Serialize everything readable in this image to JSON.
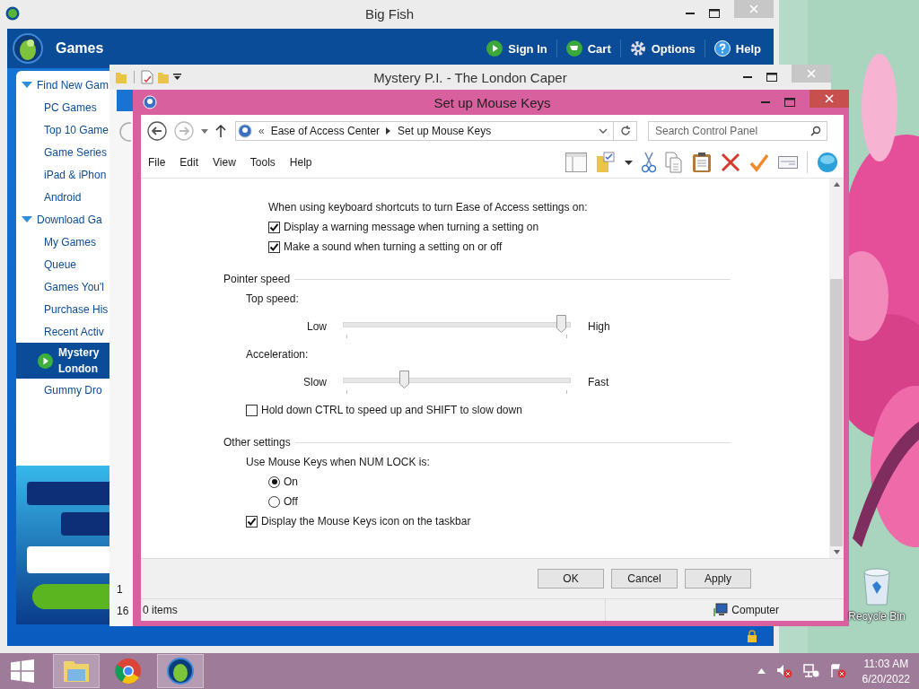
{
  "desktop": {
    "icons": [
      {
        "label": "Recycle Bin"
      }
    ]
  },
  "big_fish": {
    "title": "Big Fish",
    "brand": "Games",
    "nav": [
      {
        "kind": "play",
        "label": "Sign In"
      },
      {
        "kind": "cart",
        "label": "Cart"
      },
      {
        "kind": "gear",
        "label": "Options"
      },
      {
        "kind": "help",
        "label": "Help"
      }
    ],
    "sidebar": [
      {
        "kind": "header",
        "label": "Find New Gam",
        "expanded": true,
        "children": [
          {
            "lines": [
              "PC Games"
            ],
            "selected": false
          },
          {
            "lines": [
              "Top 10 Game"
            ],
            "selected": false
          },
          {
            "lines": [
              "Game Series"
            ],
            "selected": false
          },
          {
            "lines": [
              "iPad & iPhon"
            ],
            "selected": false
          },
          {
            "lines": [
              "Android"
            ],
            "selected": false
          }
        ]
      },
      {
        "kind": "header",
        "label": "Download Ga",
        "expanded": true,
        "children": [
          {
            "lines": [
              "My Games"
            ],
            "selected": false
          },
          {
            "lines": [
              "Queue"
            ],
            "selected": false
          },
          {
            "lines": [
              "Games You'l"
            ],
            "selected": false
          },
          {
            "lines": [
              "Purchase His"
            ],
            "selected": false
          },
          {
            "lines": [
              "Recent Activ"
            ],
            "selected": false
          },
          {
            "lines": [
              "Mystery",
              "London"
            ],
            "selected": true
          },
          {
            "lines": [
              "Gummy Dro"
            ],
            "selected": false
          }
        ]
      }
    ]
  },
  "mystery_window": {
    "title": "Mystery P.I. - The London Caper",
    "fragments": [
      "1",
      "16"
    ]
  },
  "mouse_keys": {
    "title": "Set up Mouse Keys",
    "nav": [
      {
        "kind": "back",
        "disabled": false
      },
      {
        "kind": "forward",
        "disabled": true
      }
    ],
    "address_prefix": "«",
    "breadcrumbs": [
      "Ease of Access Center",
      "Set up Mouse Keys"
    ],
    "search": {
      "placeholder": "Search Control Panel"
    },
    "menu": [
      "File",
      "Edit",
      "View",
      "Tools",
      "Help"
    ],
    "settings": [
      {
        "kind": "subsection",
        "label": "When using keyboard shortcuts to turn Ease of Access settings on:",
        "children": [
          {
            "kind": "checkbox",
            "label": "Display a warning message when turning a setting on",
            "checked": true
          },
          {
            "kind": "checkbox",
            "label": "Make a sound when turning a setting on or off",
            "checked": true
          }
        ]
      },
      {
        "kind": "group",
        "label": "Pointer speed",
        "children": [
          {
            "kind": "label",
            "label": "Top speed:"
          },
          {
            "kind": "slider",
            "min_label": "Low",
            "max_label": "High",
            "level": 0.98
          },
          {
            "kind": "label",
            "label": "Acceleration:"
          },
          {
            "kind": "slider",
            "min_label": "Slow",
            "max_label": "Fast",
            "level": 0.26
          },
          {
            "kind": "checkbox",
            "label": "Hold down CTRL to speed up and SHIFT to slow down",
            "checked": false
          }
        ]
      },
      {
        "kind": "group",
        "label": "Other settings",
        "children": [
          {
            "kind": "subsection",
            "label": "Use Mouse Keys when NUM LOCK is:",
            "children": [
              {
                "kind": "radio",
                "label": "On",
                "selected": true
              },
              {
                "kind": "radio",
                "label": "Off",
                "selected": false
              }
            ]
          },
          {
            "kind": "checkbox",
            "label": "Display the Mouse Keys icon on the taskbar",
            "checked": true
          }
        ]
      }
    ],
    "buttons": [
      "OK",
      "Cancel",
      "Apply"
    ],
    "status": {
      "items": "0 items",
      "zone": "Computer"
    }
  },
  "taskbar": {
    "apps": [
      {
        "kind": "explorer",
        "active": true
      },
      {
        "kind": "chrome",
        "active": false
      },
      {
        "kind": "games",
        "active": true
      }
    ],
    "time": "11:03 AM",
    "date": "6/20/2022"
  }
}
